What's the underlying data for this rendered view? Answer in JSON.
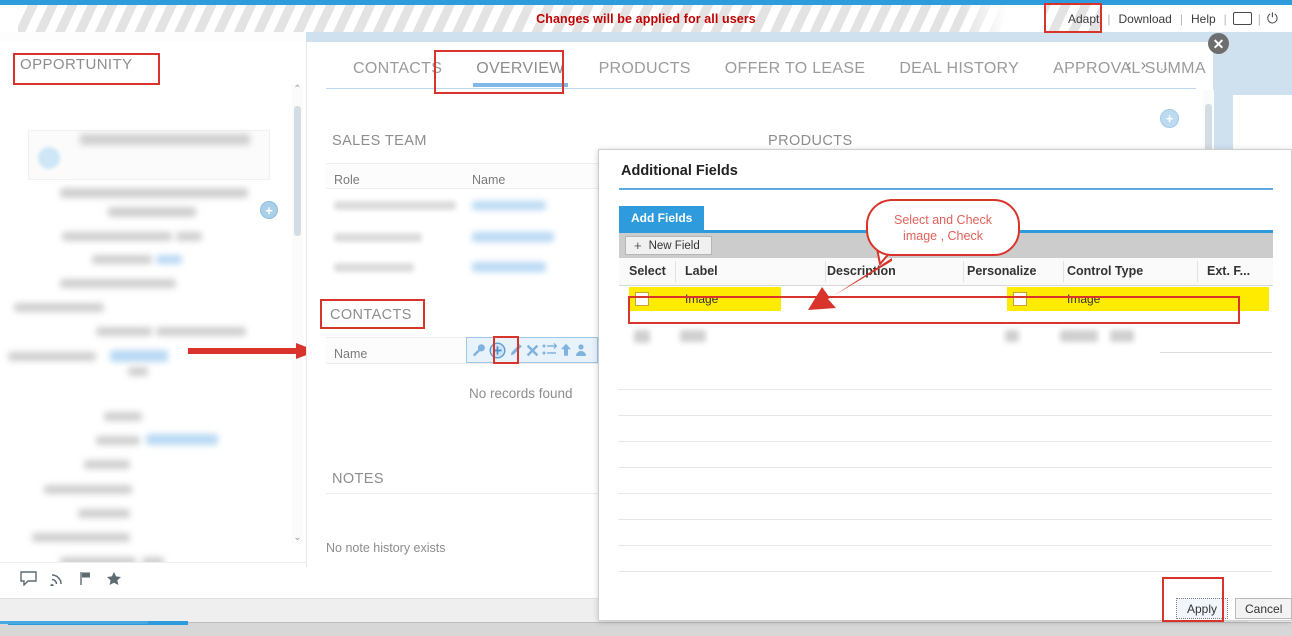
{
  "chrome": {
    "banner_text": "Changes will be applied for all users",
    "links": [
      "Adapt",
      "Download",
      "Help"
    ],
    "separator": "|",
    "window_icon": "window-icon",
    "power_icon": "power-icon"
  },
  "left_panel": {
    "title": "OPPORTUNITY",
    "footer_icons": [
      "comment-icon",
      "feed-icon",
      "flag-icon",
      "star-icon"
    ],
    "scroll_up": "⌃",
    "scroll_down": "⌄"
  },
  "tabs": {
    "items": [
      {
        "label": "CONTACTS",
        "active": false
      },
      {
        "label": "OVERVIEW",
        "active": true
      },
      {
        "label": "PRODUCTS",
        "active": false
      },
      {
        "label": "OFFER TO LEASE",
        "active": false
      },
      {
        "label": "DEAL HISTORY",
        "active": false
      },
      {
        "label": "APPROVAL SUMMA",
        "active": false
      }
    ],
    "prev_icon": "‹",
    "next_icon": "›",
    "overflow_icon": "..."
  },
  "sections": {
    "sales_team": {
      "title": "SALES TEAM",
      "columns": [
        "Role",
        "Name"
      ]
    },
    "products": {
      "title": "PRODUCTS",
      "add_icon": "plus-icon"
    },
    "contacts": {
      "title": "CONTACTS",
      "columns": [
        "Name"
      ],
      "empty_text": "No records found",
      "toolbar_icons": [
        "wrench-icon",
        "add-icon",
        "edit-icon",
        "delete-icon",
        "sort-icon",
        "up-icon",
        "assign-icon"
      ]
    },
    "notes": {
      "title": "NOTES",
      "empty_text": "No note history exists"
    }
  },
  "dialog": {
    "title": "Additional Fields",
    "tab_label": "Add Fields",
    "new_field_button": "New Field",
    "new_field_icon": "plus-icon",
    "columns": [
      "Select",
      "Label",
      "Description",
      "Personalize",
      "Control Type",
      "Ext. F..."
    ],
    "rows": [
      {
        "select": "",
        "label": "Image",
        "description": "",
        "personalize": "",
        "control_type": "Image",
        "ext_f": ""
      }
    ],
    "apply_button": "Apply",
    "cancel_button": "Cancel",
    "close_icon": "close-icon"
  },
  "callout": {
    "line1": "Select and Check",
    "line2": "image , Check"
  },
  "colors": {
    "accent_blue": "#2e9bdd",
    "annotation_red": "#d9342b",
    "banner_red": "#c00000",
    "highlight_yellow": "#ffeb00",
    "callout_text": "#e2615a"
  }
}
